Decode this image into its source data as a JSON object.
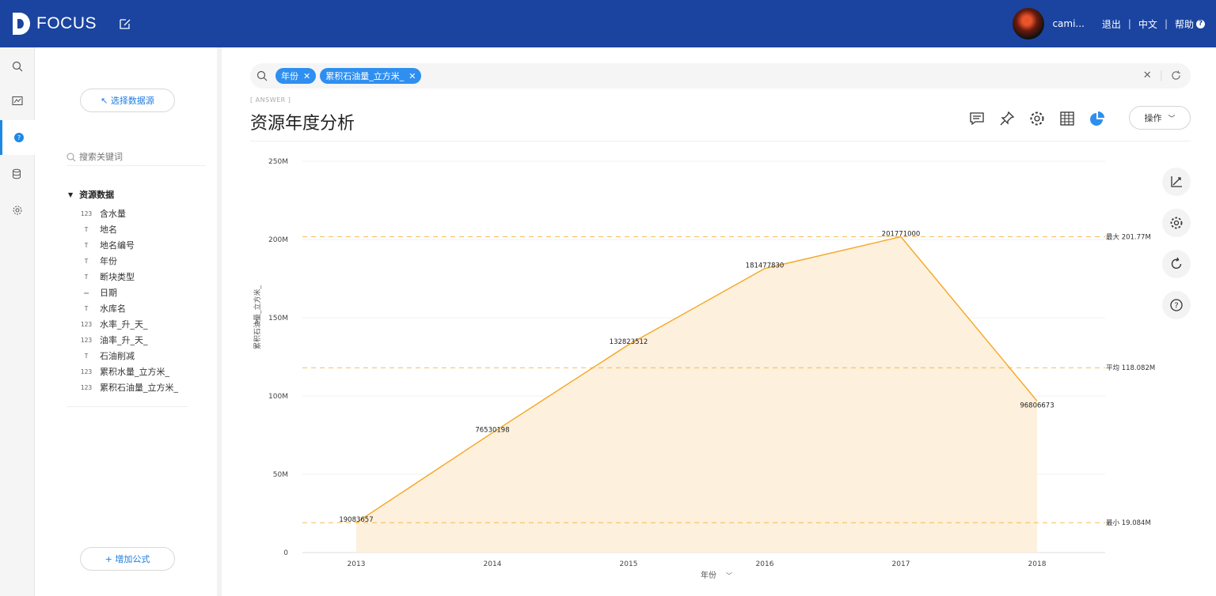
{
  "app": {
    "logo_text": "FOCUS"
  },
  "header": {
    "username": "cami...",
    "logout": "退出",
    "language": "中文",
    "help": "帮助"
  },
  "panel": {
    "select_source": "↖ 选择数据源",
    "search_placeholder": "搜索关键词",
    "tree_title": "资源数据",
    "fields": [
      {
        "name": "含水量",
        "type": "number"
      },
      {
        "name": "地名",
        "type": "text"
      },
      {
        "name": "地名编号",
        "type": "text"
      },
      {
        "name": "年份",
        "type": "text"
      },
      {
        "name": "断块类型",
        "type": "text"
      },
      {
        "name": "日期",
        "type": "date"
      },
      {
        "name": "水库名",
        "type": "text"
      },
      {
        "name": "水率_升_天_",
        "type": "number"
      },
      {
        "name": "油率_升_天_",
        "type": "number"
      },
      {
        "name": "石油削减",
        "type": "text"
      },
      {
        "name": "累积水量_立方米_",
        "type": "number"
      },
      {
        "name": "累积石油量_立方米_",
        "type": "number"
      }
    ],
    "add_formula": "+ 增加公式"
  },
  "query": {
    "tokens": [
      "年份",
      "累积石油量_立方米_"
    ]
  },
  "answer": {
    "tag": "[ ANSWER ]",
    "title": "资源年度分析",
    "ops_label": "操作"
  },
  "colors": {
    "header": "#1a44a0",
    "accent": "#2f8ff0",
    "line": "#f5a623",
    "area": "#fdf0dc",
    "refline": "#f5a623"
  },
  "chart_data": {
    "type": "area",
    "x": [
      "2013",
      "2014",
      "2015",
      "2016",
      "2017",
      "2018"
    ],
    "series": [
      {
        "name": "累积石油量_立方米_",
        "values": [
          19083657,
          76530198,
          132823512,
          181477830,
          201771000,
          96806673
        ]
      }
    ],
    "data_labels": [
      "19083657",
      "76530198",
      "132823512",
      "181477830",
      "201771000",
      "96806673"
    ],
    "ylabel": "累积石油量_立方米_",
    "xlabel": "年份",
    "ylim": [
      0,
      250000000
    ],
    "yticks": [
      "0",
      "50M",
      "100M",
      "150M",
      "200M",
      "250M"
    ],
    "ytick_values": [
      0,
      50000000,
      100000000,
      150000000,
      200000000,
      250000000
    ],
    "reference_lines": [
      {
        "label": "最大 201.77M",
        "value": 201770000
      },
      {
        "label": "平均 118.082M",
        "value": 118082000
      },
      {
        "label": "最小 19.084M",
        "value": 19084000
      }
    ],
    "grid": true
  }
}
